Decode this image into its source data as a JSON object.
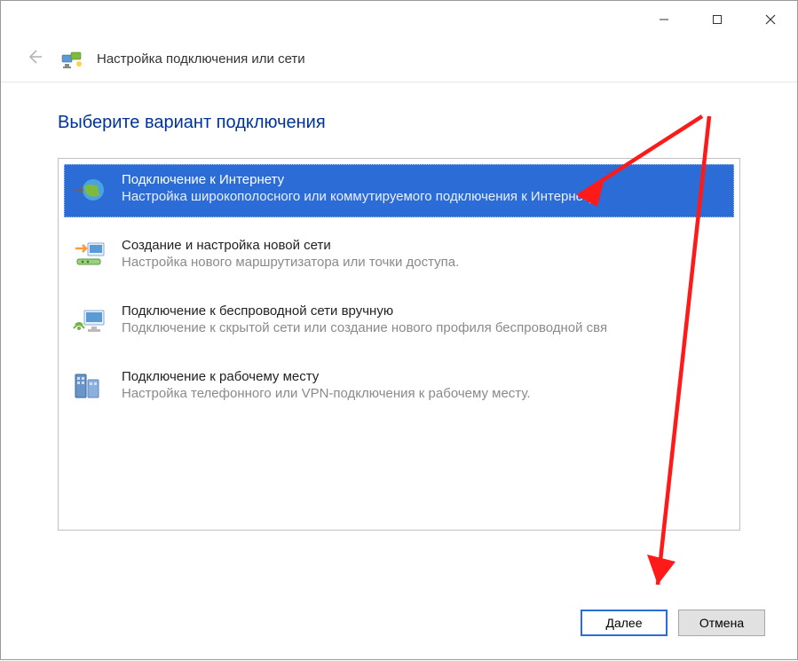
{
  "window": {
    "title": "Настройка подключения или сети"
  },
  "heading": "Выберите вариант подключения",
  "options": [
    {
      "title": "Подключение к Интернету",
      "desc": "Настройка широкополосного или коммутируемого подключения к Интернету."
    },
    {
      "title": "Создание и настройка новой сети",
      "desc": "Настройка нового маршрутизатора или точки доступа."
    },
    {
      "title": "Подключение к беспроводной сети вручную",
      "desc": "Подключение к скрытой сети или создание нового профиля беспроводной свя"
    },
    {
      "title": "Подключение к рабочему месту",
      "desc": "Настройка телефонного или VPN-подключения к рабочему месту."
    }
  ],
  "footer": {
    "next": "Далее",
    "cancel": "Отмена"
  }
}
